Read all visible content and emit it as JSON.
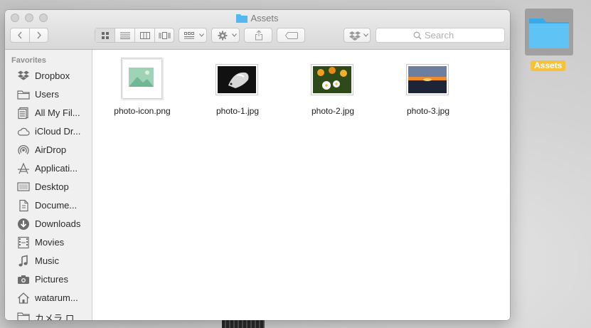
{
  "desktop": {
    "folder_label": "Assets"
  },
  "window": {
    "title": "Assets",
    "search": {
      "placeholder": "Search"
    }
  },
  "sidebar": {
    "heading": "Favorites",
    "items": [
      {
        "label": "Dropbox",
        "icon": "dropbox-icon"
      },
      {
        "label": "Users",
        "icon": "folder-icon"
      },
      {
        "label": "All My Fil...",
        "icon": "all-files-icon"
      },
      {
        "label": "iCloud Dr...",
        "icon": "cloud-icon"
      },
      {
        "label": "AirDrop",
        "icon": "airdrop-icon"
      },
      {
        "label": "Applicati...",
        "icon": "applications-icon"
      },
      {
        "label": "Desktop",
        "icon": "desktop-icon"
      },
      {
        "label": "Docume...",
        "icon": "document-icon"
      },
      {
        "label": "Downloads",
        "icon": "download-icon"
      },
      {
        "label": "Movies",
        "icon": "film-icon"
      },
      {
        "label": "Music",
        "icon": "music-note-icon"
      },
      {
        "label": "Pictures",
        "icon": "camera-icon"
      },
      {
        "label": "watarum...",
        "icon": "home-icon"
      },
      {
        "label": "カメラ ロ...",
        "icon": "folder-icon"
      }
    ]
  },
  "files": [
    {
      "name": "photo-icon.png"
    },
    {
      "name": "photo-1.jpg"
    },
    {
      "name": "photo-2.jpg"
    },
    {
      "name": "photo-3.jpg"
    }
  ]
}
